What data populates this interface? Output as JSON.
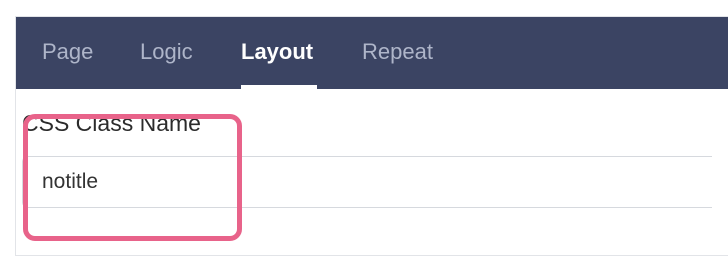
{
  "tabs": {
    "page_label": "Page",
    "logic_label": "Logic",
    "layout_label": "Layout",
    "repeat_label": "Repeat",
    "active": "Layout"
  },
  "form": {
    "css_class_label": "CSS Class Name",
    "css_class_value": "notitle"
  },
  "colors": {
    "tabbar_background": "#3b4463",
    "highlight_border": "#e8638a"
  }
}
